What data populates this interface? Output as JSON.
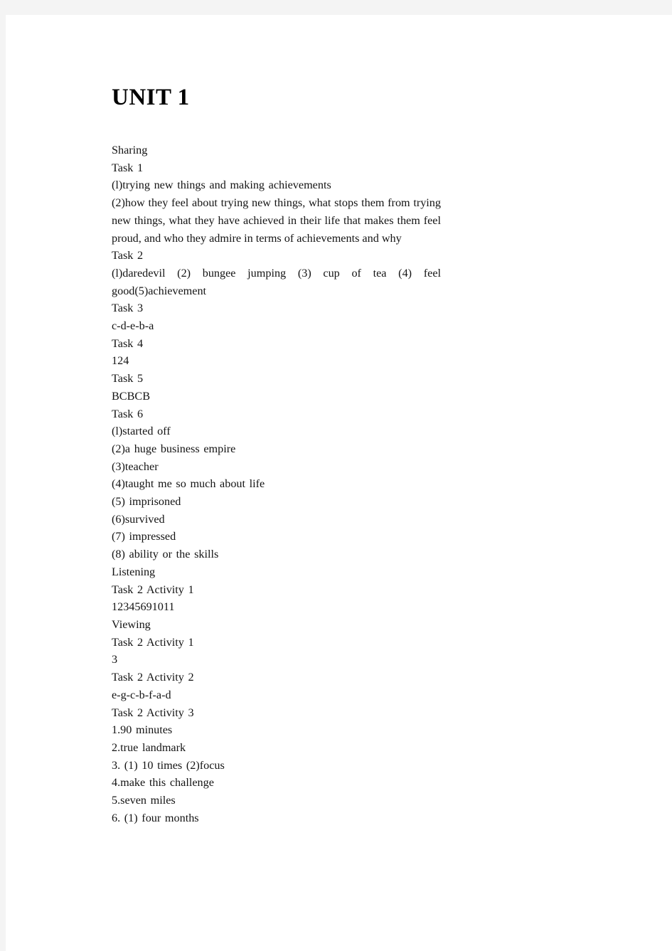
{
  "page": {
    "title": "UNIT 1",
    "background_color": "#f4f4f4",
    "sheet_color": "#ffffff",
    "text_color": "#141414"
  },
  "content": {
    "lines": [
      {
        "text": "Sharing",
        "wrap": false
      },
      {
        "text": "Task 1",
        "wrap": false
      },
      {
        "text": "(l)trying new things and making achievements",
        "wrap": false
      },
      {
        "text": "(2)how they feel about trying new things, what stops them from trying new things, what they have achieved in their life that makes them feel proud, and who they admire in terms of achievements and why",
        "wrap": true
      },
      {
        "text": "Task 2",
        "wrap": false
      },
      {
        "text": "(l)daredevil (2) bungee jumping (3) cup of tea (4) feel good(5)achievement",
        "wrap": true
      },
      {
        "text": "Task 3",
        "wrap": false
      },
      {
        "text": "c-d-e-b-a",
        "wrap": false
      },
      {
        "text": "Task 4",
        "wrap": false
      },
      {
        "text": "124",
        "wrap": false
      },
      {
        "text": "Task 5",
        "wrap": false
      },
      {
        "text": "BCBCB",
        "wrap": false
      },
      {
        "text": "Task 6",
        "wrap": false
      },
      {
        "text": "(l)started off",
        "wrap": false
      },
      {
        "text": "(2)a huge business empire",
        "wrap": false
      },
      {
        "text": "(3)teacher",
        "wrap": false
      },
      {
        "text": "(4)taught me so much about life",
        "wrap": false
      },
      {
        "text": "(5) imprisoned",
        "wrap": false
      },
      {
        "text": "(6)survived",
        "wrap": false
      },
      {
        "text": "(7) impressed",
        "wrap": false
      },
      {
        "text": "(8) ability or the skills",
        "wrap": false
      },
      {
        "text": "Listening",
        "wrap": false
      },
      {
        "text": "Task 2 Activity 1",
        "wrap": false
      },
      {
        "text": "12345691011",
        "wrap": false
      },
      {
        "text": "Viewing",
        "wrap": false
      },
      {
        "text": "Task 2 Activity 1",
        "wrap": false
      },
      {
        "text": "3",
        "wrap": false
      },
      {
        "text": "Task 2 Activity 2",
        "wrap": false
      },
      {
        "text": "e-g-c-b-f-a-d",
        "wrap": false
      },
      {
        "text": "Task 2 Activity 3",
        "wrap": false
      },
      {
        "text": "1.90 minutes",
        "wrap": false
      },
      {
        "text": "2.true landmark",
        "wrap": false
      },
      {
        "text": "3. (1) 10 times (2)focus",
        "wrap": false
      },
      {
        "text": "4.make this challenge",
        "wrap": false
      },
      {
        "text": "5.seven miles",
        "wrap": false
      },
      {
        "text": "6. (1) four months",
        "wrap": false
      }
    ]
  }
}
